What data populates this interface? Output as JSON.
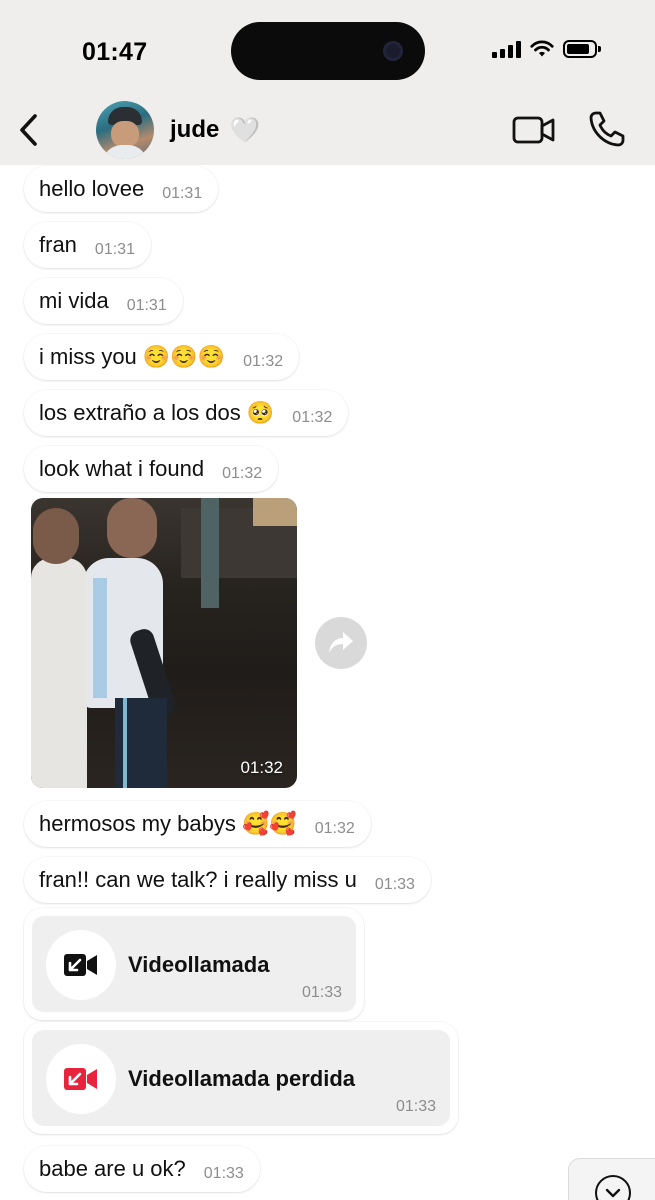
{
  "status_bar": {
    "time": "01:47",
    "battery_level": 0.85,
    "icons": [
      "signal-icon",
      "wifi-icon",
      "battery-icon"
    ]
  },
  "header": {
    "contact_name": "jude",
    "contact_emoji": "🤍",
    "icons": [
      "back-icon",
      "avatar",
      "video-camera-icon",
      "phone-icon"
    ]
  },
  "messages": [
    {
      "text": "hello lovee",
      "time": "01:31"
    },
    {
      "text": "fran",
      "time": "01:31"
    },
    {
      "text": "mi vida",
      "time": "01:31"
    },
    {
      "text": "i miss you ☺️☺️☺️",
      "time": "01:32"
    },
    {
      "text": "los extraño a los dos 🥺",
      "time": "01:32"
    },
    {
      "text": "look what i found",
      "time": "01:32"
    }
  ],
  "media": {
    "time": "01:32",
    "share_icon": "share-arrow-icon"
  },
  "messages_after": [
    {
      "text": "hermosos my babys 🥰🥰",
      "time": "01:32"
    },
    {
      "text": "fran!! can we talk? i really miss u",
      "time": "01:33"
    }
  ],
  "calls": [
    {
      "title": "Videollamada",
      "time": "01:33",
      "icon": "incoming-video-call-icon",
      "color": "#111111"
    },
    {
      "title": "Videollamada perdida",
      "time": "01:33",
      "icon": "missed-video-call-icon",
      "color": "#e8243d"
    }
  ],
  "last_message": {
    "text": "babe are u ok?",
    "time": "01:33"
  },
  "scroll_button_icon": "chevron-down-icon"
}
